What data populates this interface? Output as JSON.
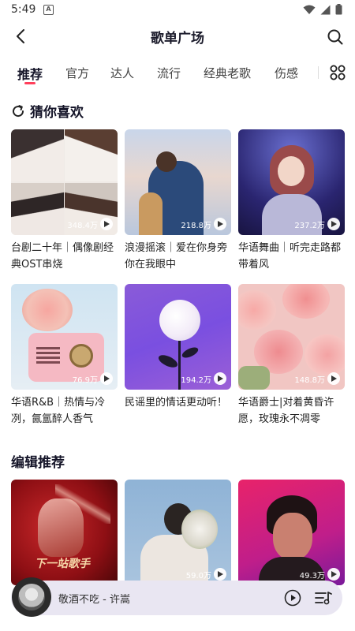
{
  "status": {
    "time": "5:49",
    "notif_glyph": "A"
  },
  "header": {
    "title": "歌单广场"
  },
  "tabs": [
    "推荐",
    "官方",
    "达人",
    "流行",
    "经典老歌",
    "伤感"
  ],
  "sections": {
    "guess": {
      "title": "猜你喜欢",
      "cards": [
        {
          "title": "台剧二十年｜偶像剧经典OST串烧",
          "plays": "348.4万"
        },
        {
          "title": "浪漫摇滚｜爱在你身旁你在我眼中",
          "plays": "218.8万"
        },
        {
          "title": "华语舞曲｜听完走路都带着风",
          "plays": "237.2万"
        },
        {
          "title": "华语R&B｜热情与冷冽，氤氲醉人香气",
          "plays": "76.9万"
        },
        {
          "title": "民谣里的情话更动听！",
          "plays": "194.2万"
        },
        {
          "title": "华语爵士|对着黄昏许愿，玫瑰永不凋零",
          "plays": "148.8万"
        }
      ]
    },
    "editor": {
      "title": "编辑推荐",
      "cards": [
        {
          "plays": "",
          "art_text": "下一站歌手"
        },
        {
          "plays": "59.0万"
        },
        {
          "plays": "49.3万"
        }
      ]
    }
  },
  "mini_player": {
    "title": "敬酒不吃 - 许嵩"
  },
  "colors": {
    "accent": "#ff3f5b",
    "mini_bg": "#e9e6f2"
  },
  "icons": [
    "back-arrow-icon",
    "search-icon",
    "grid-icon",
    "refresh-icon",
    "play-icon",
    "playlist-icon"
  ]
}
